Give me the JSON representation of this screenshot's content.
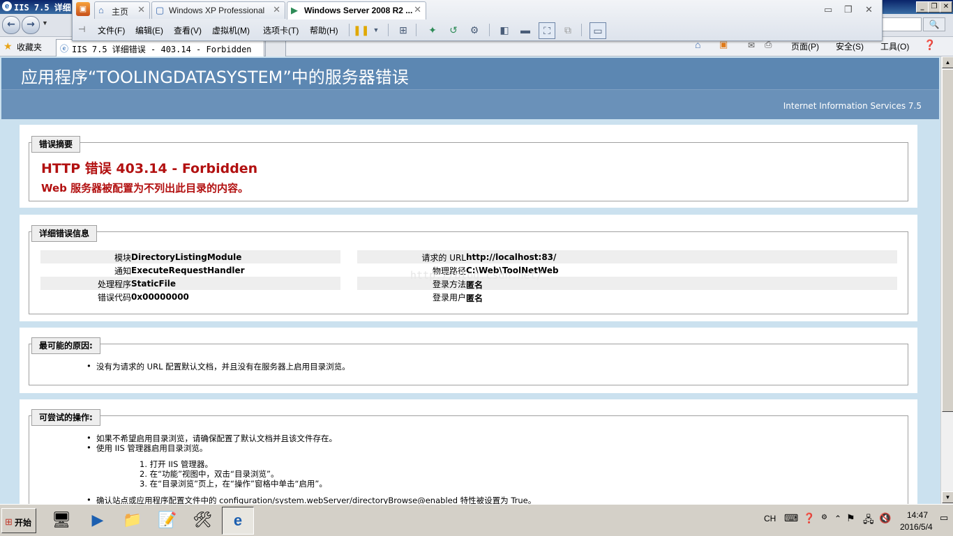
{
  "ie": {
    "title": "IIS 7.5 详细",
    "tab_title": "IIS 7.5 详细错误 - 403.14 - Forbidden",
    "favorites": "收藏夹",
    "commands": {
      "page": "页面(P)",
      "security": "安全(S)",
      "tools": "工具(O)"
    }
  },
  "vmware": {
    "tabs": [
      {
        "label": "主页"
      },
      {
        "label": "Windows XP Professional"
      },
      {
        "label": "Windows Server 2008 R2 ..."
      }
    ],
    "menu": [
      "文件(F)",
      "编辑(E)",
      "查看(V)",
      "虚拟机(M)",
      "选项卡(T)",
      "帮助(H)"
    ]
  },
  "page": {
    "header": "应用程序“TOOLINGDATASYSTEM”中的服务器错误",
    "iis_version": "Internet Information Services 7.5",
    "summary": {
      "legend": "错误摘要",
      "title": "HTTP 错误 403.14 - Forbidden",
      "subtitle": "Web 服务器被配置为不列出此目录的内容。"
    },
    "details": {
      "legend": "详细错误信息",
      "left": [
        {
          "label": "模块",
          "value": "DirectoryListingModule"
        },
        {
          "label": "通知",
          "value": "ExecuteRequestHandler"
        },
        {
          "label": "处理程序",
          "value": "StaticFile"
        },
        {
          "label": "错误代码",
          "value": "0x00000000"
        }
      ],
      "right": [
        {
          "label": "请求的 URL",
          "value": "http://localhost:83/"
        },
        {
          "label": "物理路径",
          "value": "C:\\Web\\ToolNetWeb"
        },
        {
          "label": "登录方法",
          "value": "匿名"
        },
        {
          "label": "登录用户",
          "value": "匿名"
        }
      ]
    },
    "causes": {
      "legend": "最可能的原因:",
      "items": [
        "没有为请求的 URL 配置默认文档，并且没有在服务器上启用目录浏览。"
      ]
    },
    "actions": {
      "legend": "可尝试的操作:",
      "items": [
        "如果不希望启用目录浏览，请确保配置了默认文档并且该文件存在。",
        "使用 IIS 管理器启用目录浏览。"
      ],
      "steps": [
        "1. 打开 IIS 管理器。",
        "2. 在“功能”视图中，双击“目录浏览”。",
        "3. 在“目录浏览”页上，在“操作”窗格中单击“启用”。"
      ],
      "last": "确认站点或应用程序配置文件中的 configuration/system.webServer/directoryBrowse@enabled 特性被设置为 True。"
    },
    "watermark": "http://blog.csdn.net/"
  },
  "taskbar": {
    "start": "开始",
    "lang": "CH",
    "time": "14:47",
    "date": "2016/5/4"
  }
}
